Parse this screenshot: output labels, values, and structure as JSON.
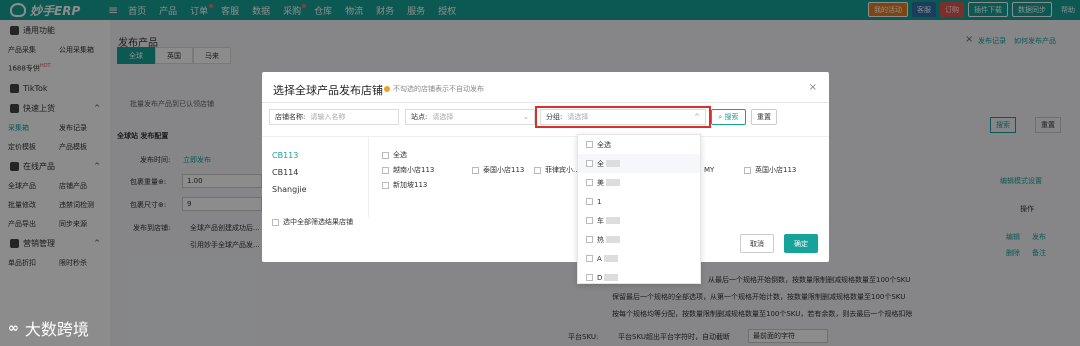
{
  "topbar": {
    "app_name": "妙手ERP",
    "nav": [
      "首页",
      "产品",
      "订单",
      "客服",
      "数据",
      "采购",
      "仓库",
      "物流",
      "财务",
      "服务",
      "授权"
    ],
    "right": {
      "promo": "我的活动",
      "avatar_label": "客服",
      "order_btn": "订购",
      "plugin": "插件下载",
      "sync": "数据同步",
      "help": "帮助"
    }
  },
  "sidebar": {
    "sections": [
      {
        "title": "通用功能",
        "rows": [
          [
            "产品采集",
            "公用采集箱"
          ],
          [
            "1688专供",
            ""
          ]
        ]
      },
      {
        "title": "TikTok",
        "rows": []
      },
      {
        "title": "快速上货",
        "rows": [
          [
            "采集箱",
            "发布记录"
          ],
          [
            "定价模板",
            "产品模板"
          ]
        ]
      },
      {
        "title": "在线产品",
        "rows": [
          [
            "全球产品",
            "店铺产品"
          ],
          [
            "批量修改",
            "违禁词检测"
          ],
          [
            "产品导出",
            "同步来源"
          ]
        ]
      },
      {
        "title": "营销管理",
        "rows": [
          [
            "单品折扣",
            "限时秒杀"
          ]
        ]
      }
    ],
    "hot_badge": "HOT"
  },
  "page": {
    "title": "发布产品",
    "links": [
      "发布记录",
      "如何发布产品"
    ],
    "bg_tabs": [
      "全球",
      "英国",
      "马来"
    ],
    "bg_notice": "批量发布产品到已认领店铺",
    "bg_labels": [
      "全球站 发布配置",
      "发布时间:",
      "包裹重量⊕:",
      "包裹尺寸⊕:",
      "发布到店铺:"
    ],
    "bg_values": [
      "1.00",
      "9"
    ],
    "bg_radio": "立即发布",
    "bg_check1": "全球产品创建成功后...",
    "bg_check2": "引用妙手全球产品发...",
    "bg_right_btns": [
      "搜索",
      "重置"
    ],
    "bg_edit_link": "编辑模式设置",
    "bg_table_header": "操作",
    "bg_ops": [
      "编辑",
      "发布",
      "删除",
      "备注"
    ],
    "bg_rules": [
      "从最后一个规格开始倒数，按数量限制删减规格数量至100个SKU",
      "保留最后一个规格的全部选项，从第一个规格开始计数，按数量限制删减规格数量至100个SKU",
      "按每个规格均等分配，按数量限制删减规格数量至100个SKU，若有余数，则去最后一个规格扣除"
    ],
    "bg_sku_label": "平台SKU:",
    "bg_sku_check": "平台SKU超出平台字符时，自动截断",
    "bg_sku_select": "最前面的字符"
  },
  "modal": {
    "title": "选择全球产品发布店铺",
    "hint": "不勾选的店铺表示不自动发布",
    "filters": {
      "store_label": "店铺名称:",
      "store_placeholder": "请输入名称",
      "site_label": "站点:",
      "site_placeholder": "请选择",
      "group_label": "分组:",
      "group_placeholder": "请选择"
    },
    "search_btn": "搜索",
    "reset_btn": "重置",
    "groups": [
      "CB113",
      "CB114",
      "Shangjie"
    ],
    "stores": {
      "select_all": "全选",
      "row1": [
        "越南小店113",
        "泰国小店113",
        "菲律宾小...",
        "MY",
        "英国小店113"
      ],
      "row2": [
        "新加坡113"
      ]
    },
    "select_all_results": "选中全部筛选结果店铺",
    "cancel_btn": "取消",
    "ok_btn": "确定"
  },
  "dropdown": {
    "items": [
      "全选",
      "全",
      "美",
      "1",
      "车",
      "热",
      "A",
      "D"
    ]
  },
  "watermark": "大数跨境",
  "colors": {
    "primary": "#16a39a",
    "highlight": "#d9302c",
    "hint_dot": "#f0a028"
  }
}
